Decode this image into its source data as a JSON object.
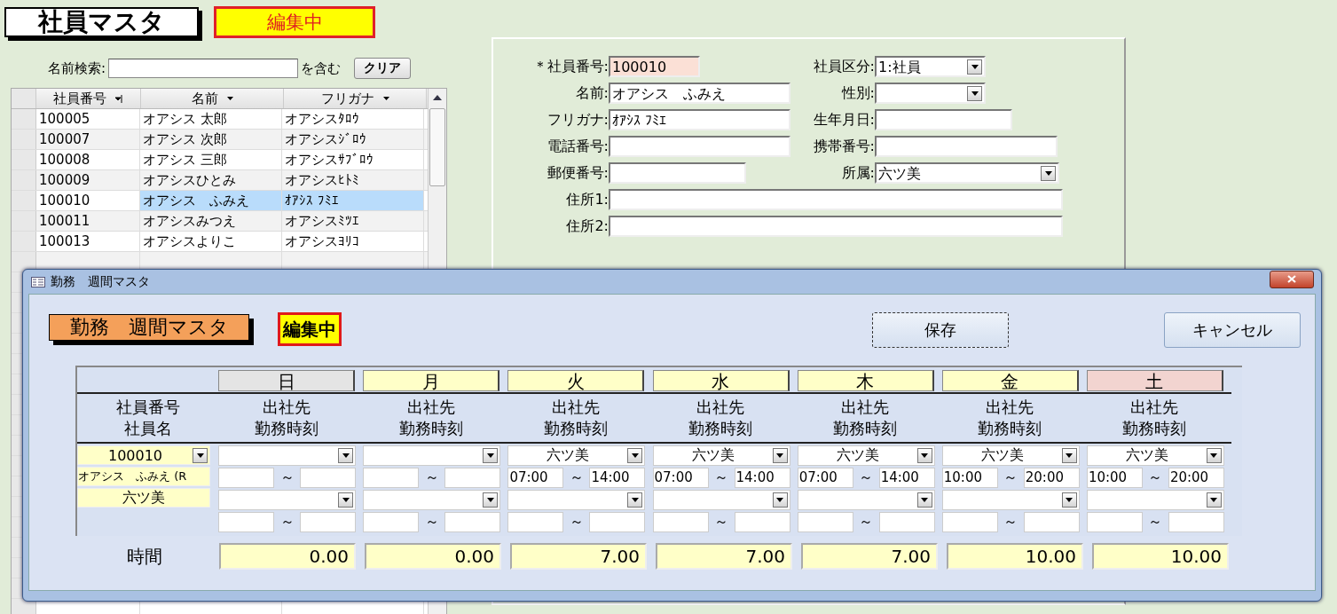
{
  "main": {
    "title": "社員マスタ",
    "status": "編集中"
  },
  "search": {
    "label": "名前検索:",
    "suffix": "を含む",
    "clear_button": "クリア"
  },
  "list": {
    "columns": [
      {
        "label": "社員番号",
        "kind": "sorted"
      },
      {
        "label": "名前",
        "kind": "filter"
      },
      {
        "label": "フリガナ",
        "kind": "filter"
      }
    ],
    "rows": [
      {
        "id": "100005",
        "name": "オアシス 太郎",
        "kana": "オアシスﾀﾛｳ",
        "selected": false
      },
      {
        "id": "100007",
        "name": "オアシス 次郎",
        "kana": "オアシスｼﾞﾛｳ",
        "selected": false
      },
      {
        "id": "100008",
        "name": "オアシス 三郎",
        "kana": "オアシスｻﾌﾞﾛｳ",
        "selected": false
      },
      {
        "id": "100009",
        "name": "オアシスひとみ",
        "kana": "オアシスﾋﾄﾐ",
        "selected": false
      },
      {
        "id": "100010",
        "name": "オアシス　ふみえ",
        "kana": "ｵｱｼｽ ﾌﾐｴ",
        "selected": true
      },
      {
        "id": "100011",
        "name": "オアシスみつえ",
        "kana": "オアシスﾐﾂｴ",
        "selected": false
      },
      {
        "id": "100013",
        "name": "オアシスよりこ",
        "kana": "オアシスﾖﾘｺ",
        "selected": false
      }
    ]
  },
  "form": {
    "required_mark": "＊",
    "left": [
      {
        "label": "社員番号:",
        "value": "100010",
        "kind": "text",
        "required": true
      },
      {
        "label": "名前:",
        "value": "オアシス　ふみえ",
        "kind": "text",
        "required": false
      },
      {
        "label": "フリガナ:",
        "value": "ｵｱｼｽ ﾌﾐｴ",
        "kind": "text",
        "required": false
      },
      {
        "label": "電話番号:",
        "kind": "text",
        "required": false
      },
      {
        "label": "郵便番号:",
        "kind": "short",
        "required": false
      }
    ],
    "right": [
      {
        "label": "社員区分:",
        "value": "1:社員",
        "kind": "combo"
      },
      {
        "label": "性別:",
        "kind": "combo"
      },
      {
        "label": "生年月日:",
        "kind": "short"
      },
      {
        "label": "携帯番号:",
        "kind": "text"
      },
      {
        "label": "所属:",
        "value": "六ツ美",
        "kind": "combo"
      }
    ],
    "full": [
      {
        "label": "住所1:"
      },
      {
        "label": "住所2:"
      }
    ]
  },
  "dialog": {
    "title": "勤務　週間マスタ",
    "heading": "勤務　週間マスタ",
    "status": "編集中",
    "buttons": [
      {
        "label": "保存",
        "focused": true
      },
      {
        "label": "キャンセル",
        "focused": false
      }
    ],
    "employee": {
      "header": [
        "社員番号",
        "社員名"
      ],
      "id": "100010",
      "name": "オアシス　ふみえ (R",
      "shop": "六ツ美"
    },
    "hours_label": "時間",
    "days": [
      {
        "label": "日",
        "color": "#e4e4e4",
        "header": [
          "出社先",
          "勤務時刻"
        ],
        "hours": "0.00"
      },
      {
        "label": "月",
        "color": "#ffffc8",
        "header": [
          "出社先",
          "勤務時刻"
        ],
        "hours": "0.00"
      },
      {
        "label": "火",
        "color": "#ffffc8",
        "header": [
          "出社先",
          "勤務時刻"
        ],
        "shifts": [
          {
            "place": "六ツ美",
            "start": "07:00",
            "end": "14:00"
          }
        ],
        "hours": "7.00"
      },
      {
        "label": "水",
        "color": "#ffffc8",
        "header": [
          "出社先",
          "勤務時刻"
        ],
        "shifts": [
          {
            "place": "六ツ美",
            "start": "07:00",
            "end": "14:00"
          }
        ],
        "hours": "7.00"
      },
      {
        "label": "木",
        "color": "#ffffc8",
        "header": [
          "出社先",
          "勤務時刻"
        ],
        "shifts": [
          {
            "place": "六ツ美",
            "start": "07:00",
            "end": "14:00"
          }
        ],
        "hours": "7.00"
      },
      {
        "label": "金",
        "color": "#ffffc8",
        "header": [
          "出社先",
          "勤務時刻"
        ],
        "shifts": [
          {
            "place": "六ツ美",
            "start": "10:00",
            "end": "20:00"
          }
        ],
        "hours": "10.00"
      },
      {
        "label": "土",
        "color": "#f2d4d0",
        "header": [
          "出社先",
          "勤務時刻"
        ],
        "shifts": [
          {
            "place": "六ツ美",
            "start": "10:00",
            "end": "20:00"
          }
        ],
        "hours": "10.00"
      }
    ],
    "tilde": "～"
  }
}
